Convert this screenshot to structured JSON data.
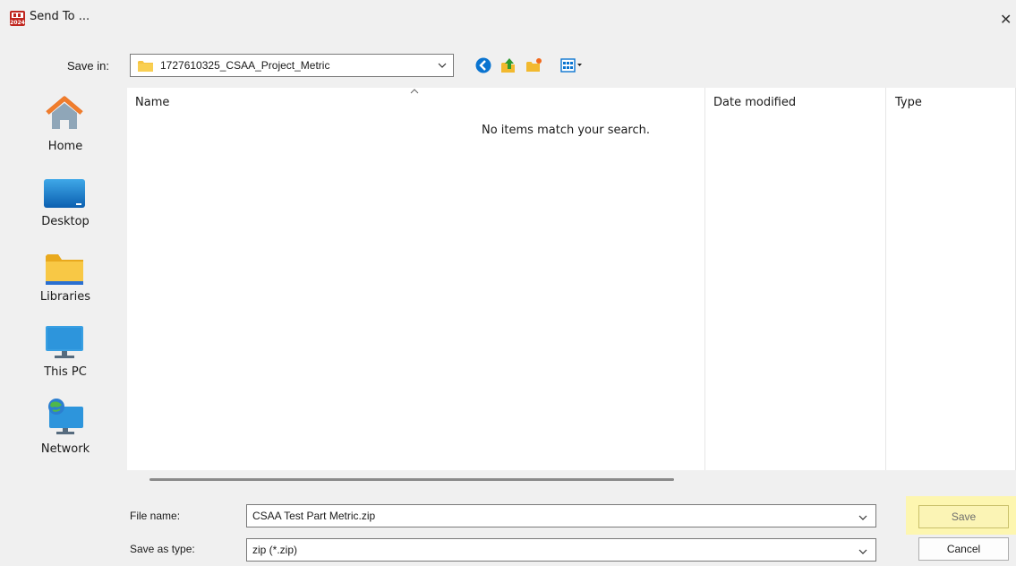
{
  "window": {
    "title": "Send To ...",
    "app_icon_text": "2024",
    "close_glyph": "✕"
  },
  "toolbar": {
    "save_in_label": "Save in:",
    "save_in_value": "1727610325_CSAA_Project_Metric",
    "icons": [
      "back-icon",
      "up-folder-icon",
      "new-folder-icon",
      "view-menu-icon"
    ]
  },
  "places": [
    {
      "label": "Home",
      "icon": "home-icon"
    },
    {
      "label": "Desktop",
      "icon": "desktop-icon"
    },
    {
      "label": "Libraries",
      "icon": "libraries-icon"
    },
    {
      "label": "This PC",
      "icon": "this-pc-icon"
    },
    {
      "label": "Network",
      "icon": "network-icon"
    }
  ],
  "file_list": {
    "columns": [
      "Name",
      "Date modified",
      "Type"
    ],
    "empty_message": "No items match your search."
  },
  "form": {
    "file_name_label": "File name:",
    "file_name_value": "CSAA Test Part Metric.zip",
    "save_type_label": "Save as type:",
    "save_type_value": "zip (*.zip)"
  },
  "buttons": {
    "save": "Save",
    "cancel": "Cancel"
  },
  "colors": {
    "highlight": "#fdf6b0",
    "folder": "#f6c443",
    "accent_blue": "#0a74d0"
  }
}
